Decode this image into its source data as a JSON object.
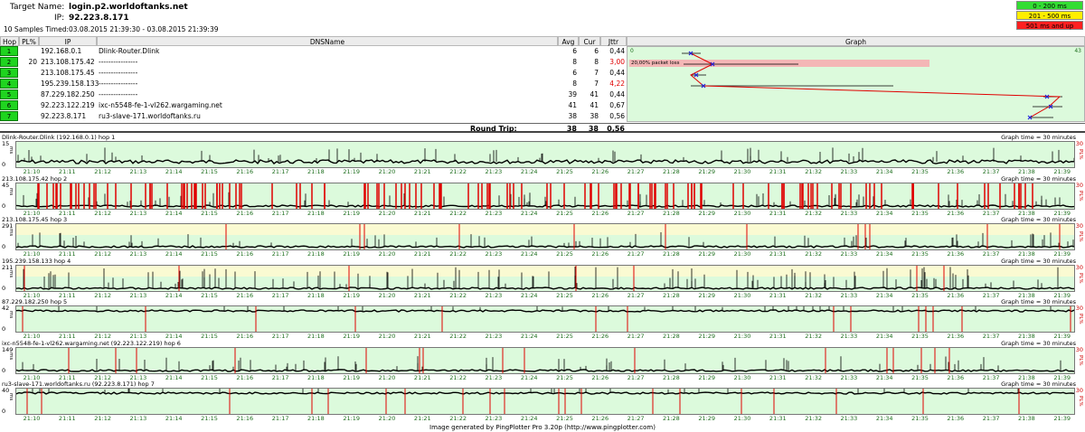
{
  "header": {
    "target_label": "Target Name:",
    "target_value": "login.p2.worldoftanks.net",
    "ip_label": "IP:",
    "ip_value": "92.223.8.171",
    "samples_text": "10 Samples Timed:",
    "time_range": "03.08.2015 21:39:30 - 03.08.2015 21:39:39"
  },
  "legend": [
    {
      "label": "0 - 200 ms",
      "color": "#33dd33"
    },
    {
      "label": "201 - 500 ms",
      "color": "#ffee00"
    },
    {
      "label": "501 ms and up",
      "color": "#ff2020"
    }
  ],
  "columns": {
    "hop": "Hop",
    "pl": "PL%",
    "ip": "IP",
    "dns": "DNSName",
    "avg": "Avg",
    "cur": "Cur",
    "jttr": "Jttr",
    "graph": "Graph"
  },
  "graph_scale": {
    "min": "0",
    "max": "43",
    "loss_text": "20,00% packet loss"
  },
  "hops": [
    {
      "hop": "1",
      "pl": "",
      "ip": "192.168.0.1",
      "dns": "Dlink-Router.Dlink",
      "avg": "6",
      "cur": "6",
      "jttr": "0,44",
      "jttr_red": false
    },
    {
      "hop": "2",
      "pl": "20",
      "ip": "213.108.175.42",
      "dns": "----------------",
      "avg": "8",
      "cur": "8",
      "jttr": "3,00",
      "jttr_red": true
    },
    {
      "hop": "3",
      "pl": "",
      "ip": "213.108.175.45",
      "dns": "----------------",
      "avg": "6",
      "cur": "7",
      "jttr": "0,44",
      "jttr_red": false
    },
    {
      "hop": "4",
      "pl": "",
      "ip": "195.239.158.133",
      "dns": "----------------",
      "avg": "8",
      "cur": "7",
      "jttr": "4,22",
      "jttr_red": true
    },
    {
      "hop": "5",
      "pl": "",
      "ip": "87.229.182.250",
      "dns": "----------------",
      "avg": "39",
      "cur": "41",
      "jttr": "0,44",
      "jttr_red": false
    },
    {
      "hop": "6",
      "pl": "",
      "ip": "92.223.122.219",
      "dns": "ixc-n5548-fe-1-vl262.wargaming.net",
      "avg": "41",
      "cur": "41",
      "jttr": "0,67",
      "jttr_red": false
    },
    {
      "hop": "7",
      "pl": "",
      "ip": "92.223.8.171",
      "dns": "ru3-slave-171.worldoftanks.ru",
      "avg": "38",
      "cur": "38",
      "jttr": "0,56",
      "jttr_red": false
    }
  ],
  "round_trip": {
    "label": "Round Trip:",
    "avg": "38",
    "cur": "38",
    "jttr": "0,56"
  },
  "graph_time": "Graph time = 30 minutes",
  "time_labels": [
    "21:10",
    "21:11",
    "21:12",
    "21:13",
    "21:14",
    "21:15",
    "21:16",
    "21:17",
    "21:18",
    "21:19",
    "21:20",
    "21:21",
    "21:22",
    "21:23",
    "21:24",
    "21:25",
    "21:26",
    "21:27",
    "21:28",
    "21:29",
    "21:30",
    "21:31",
    "21:32",
    "21:33",
    "21:34",
    "21:35",
    "21:36",
    "21:37",
    "21:38",
    "21:39"
  ],
  "panels": [
    {
      "title": "Dlink-Router.Dlink (192.168.0.1) hop 1",
      "ymax": "15",
      "ylow": "0",
      "ms": "ms",
      "rmax": "30",
      "pl": "PL%"
    },
    {
      "title": "213.108.175.42 hop 2",
      "ymax": "45",
      "ylow": "0",
      "ms": "ms",
      "rmax": "30",
      "pl": "PL%"
    },
    {
      "title": "213.108.175.45 hop 3",
      "ymax": "291",
      "ylow": "0",
      "ms": "ms",
      "rmax": "30",
      "pl": "PL%"
    },
    {
      "title": "195.239.158.133 hop 4",
      "ymax": "211",
      "ylow": "0",
      "ms": "ms",
      "rmax": "30",
      "pl": "PL%"
    },
    {
      "title": "87.229.182.250 hop 5",
      "ymax": "42",
      "ylow": "0",
      "ms": "ms",
      "rmax": "30",
      "pl": "PL%"
    },
    {
      "title": "ixc-n5548-fe-1-vl262.wargaming.net (92.223.122.219) hop 6",
      "ymax": "149",
      "ylow": "0",
      "ms": "ms",
      "rmax": "30",
      "pl": "PL%"
    },
    {
      "title": "ru3-slave-171.worldoftanks.ru (92.223.8.171) hop 7",
      "ymax": "40",
      "ylow": "0",
      "ms": "ms",
      "rmax": "30",
      "pl": "PL%"
    }
  ],
  "footer": "Image generated by PingPlotter Pro 3.20p (http://www.pingplotter.com)"
}
